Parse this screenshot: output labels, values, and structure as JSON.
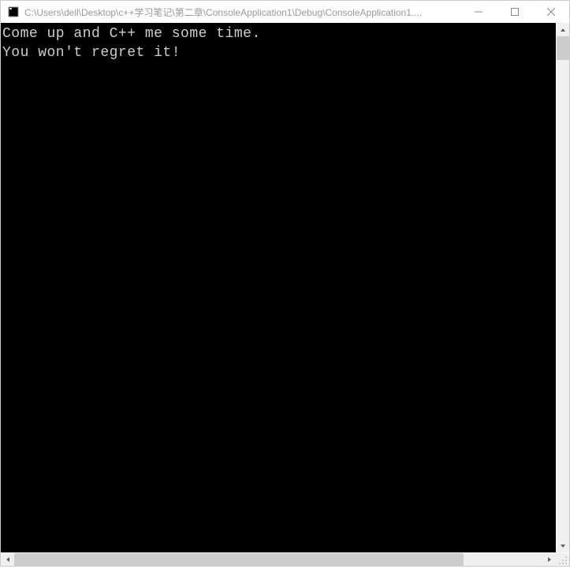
{
  "window": {
    "title": "C:\\Users\\dell\\Desktop\\c++学习笔记\\第二章\\ConsoleApplication1\\Debug\\ConsoleApplication1...."
  },
  "console": {
    "line1": "Come up and C++ me some time.",
    "line2": "You won't regret it!"
  }
}
